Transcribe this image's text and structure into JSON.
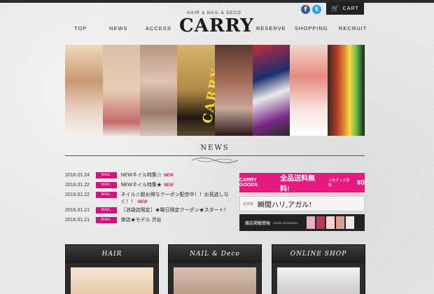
{
  "header": {
    "logo_sub": "HAIR & NAIL & DECO",
    "logo": "CARRY",
    "cart_label": "CART",
    "facebook_glyph": "f",
    "twitter_glyph": "t"
  },
  "nav": [
    "TOP",
    "NEWS",
    "ACCESS",
    "RESERVE",
    "SHOPPING",
    "RECRUIT"
  ],
  "news": {
    "title": "NEWS",
    "items": [
      {
        "date": "2016.01.24",
        "tag": "NAIL",
        "text": "NEWネイル特集☆",
        "new": "NEW"
      },
      {
        "date": "2016.01.22",
        "tag": "NAIL",
        "text": "NEWネイル特集★",
        "new": "NEW"
      },
      {
        "date": "2016.01.22",
        "tag": "NAIL",
        "text": "ネイル☆超お得なクーポン配信中！！お見逃しなく！！",
        "new": "NEW"
      },
      {
        "date": "2016.01.21",
        "tag": "NAIL",
        "text": "［池袋店限定］★曜日限定クーポン★スタート！",
        "new": ""
      },
      {
        "date": "2016.01.21",
        "tag": "NAIL",
        "text": "来店★モデル 渋谷",
        "new": ""
      }
    ]
  },
  "promos": {
    "goods_label": "CARRY GOODS",
    "shipping": "全品送料無料!",
    "shipping_small": "人気グッズ通販",
    "price": "¥0",
    "hari_label": "瞬間ハリ,アガル!",
    "hari_small": "日本初",
    "media": "雑誌掲載情報",
    "media_en": "media information"
  },
  "cards": [
    {
      "label": "HAIR"
    },
    {
      "label": "NAIL & Deco"
    },
    {
      "label": "ONLINE SHOP"
    }
  ],
  "banner_word": "CARRY",
  "colors": {
    "accent": "#d4127e",
    "dark": "#2b2b2b"
  }
}
